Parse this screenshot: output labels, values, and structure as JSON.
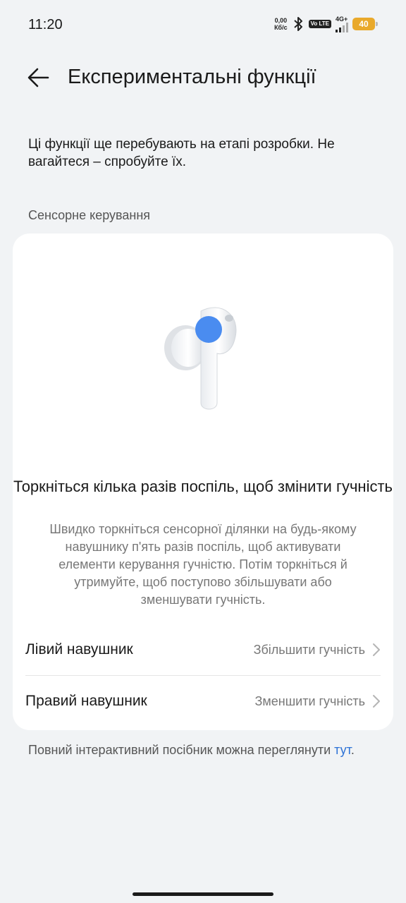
{
  "status_bar": {
    "time": "11:20",
    "net_speed_value": "0,00",
    "net_speed_unit": "Кб/с",
    "volte": "Vo LTE",
    "network": "4G+",
    "battery": "40",
    "battery_color": "#e9a92b"
  },
  "header": {
    "title": "Експериментальні функції"
  },
  "intro": "Ці функції ще перебувають на етапі розробки. Не вагайтеся – спробуйте їх.",
  "section_label": "Сенсорне керування",
  "card": {
    "title": "Торкніться кілька разів поспіль, щоб змінити гучність",
    "description": "Швидко торкніться сенсорної ділянки на будь-якому навушнику п'ять разів поспіль, щоб активувати елементи керування гучністю. Потім торкніться й утримуйте, щоб поступово збільшувати або зменшувати гучність.",
    "accent_color": "#4a8cf0",
    "rows": [
      {
        "label": "Лівий навушник",
        "value": "Збільшити гучність"
      },
      {
        "label": "Правий навушник",
        "value": "Зменшити гучність"
      }
    ]
  },
  "footer": {
    "text": "Повний інтерактивний посібник можна переглянути ",
    "link": "тут",
    "suffix": ".",
    "link_color": "#2e73d6"
  }
}
